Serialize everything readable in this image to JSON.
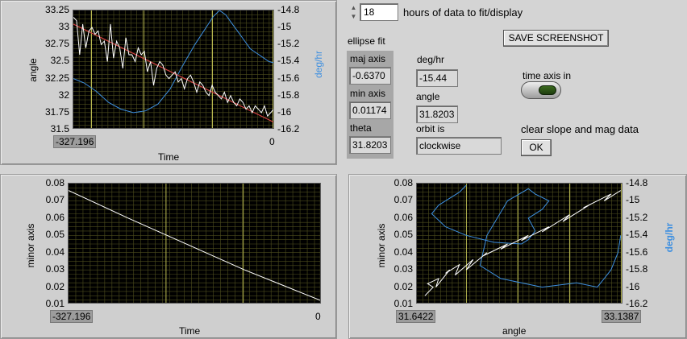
{
  "colors": {
    "panel_bg": "#d4d4d4",
    "plot_bg": "#000000",
    "grid_minor": "#4e4e1e",
    "grid_major": "#b8b850",
    "trace_white": "#ffffff",
    "trace_blue": "#3d8fe0",
    "fit_red": "#d24040",
    "toggle_led": "#2e5a14"
  },
  "controls": {
    "hours_value": "18",
    "hours_label": "hours of data to fit/display",
    "save_button": "SAVE SCREENSHOT",
    "time_axis_label": "time axis in",
    "clear_label": "clear slope and mag data",
    "ok_button": "OK"
  },
  "ellipse": {
    "title": "ellipse fit",
    "maj_axis_label": "maj axis",
    "maj_axis_value": "-0.6370",
    "min_axis_label": "min axis",
    "min_axis_value": "0.01174",
    "theta_label": "theta",
    "theta_value": "31.8203",
    "deghr_label": "deg/hr",
    "deghr_value": "-15.44",
    "angle_label": "angle",
    "angle_value": "31.8203",
    "orbit_label": "orbit is",
    "orbit_value": "clockwise"
  },
  "chart_data": [
    {
      "type": "line",
      "name": "angle vs time",
      "xlabel": "Time",
      "ylabel": "angle",
      "y2label": "deg/hr",
      "x_range_labels": [
        "-327.196",
        "0"
      ],
      "xlim": [
        -327.196,
        0
      ],
      "ylim": [
        31.5,
        33.25
      ],
      "y2lim": [
        -16.2,
        -14.8
      ],
      "yticks": [
        "33.25",
        "33",
        "32.75",
        "32.5",
        "32.25",
        "32",
        "31.75",
        "31.5"
      ],
      "y2ticks": [
        "-14.8",
        "-15",
        "-15.2",
        "-15.4",
        "-15.6",
        "-15.8",
        "-16",
        "-16.2"
      ],
      "series": [
        {
          "role": "angle",
          "color": "#ffffff",
          "axis": "left",
          "x": [
            -327,
            -322,
            -317,
            -312,
            -307,
            -302,
            -297,
            -292,
            -287,
            -282,
            -277,
            -272,
            -267,
            -262,
            -257,
            -252,
            -247,
            -242,
            -237,
            -232,
            -227,
            -222,
            -217,
            -212,
            -207,
            -202,
            -197,
            -192,
            -187,
            -182,
            -177,
            -172,
            -167,
            -162,
            -157,
            -152,
            -147,
            -142,
            -137,
            -132,
            -127,
            -122,
            -117,
            -112,
            -107,
            -102,
            -97,
            -92,
            -87,
            -82,
            -77,
            -72,
            -67,
            -62,
            -57,
            -52,
            -47,
            -42,
            -37,
            -32,
            -27,
            -22,
            -17,
            -12,
            -7,
            -2,
            0
          ],
          "y": [
            33.15,
            33.1,
            32.6,
            33.05,
            32.7,
            32.95,
            33.0,
            32.9,
            32.95,
            32.75,
            32.8,
            32.5,
            33.05,
            32.55,
            32.8,
            32.7,
            32.4,
            32.85,
            32.6,
            32.6,
            32.5,
            32.7,
            32.6,
            32.65,
            32.35,
            32.5,
            32.15,
            32.4,
            32.5,
            32.45,
            32.3,
            32.25,
            32.3,
            32.35,
            32.2,
            32.25,
            32.1,
            32.25,
            32.3,
            32.2,
            32.05,
            32.2,
            32.15,
            32.05,
            32.0,
            32.15,
            32.05,
            32.0,
            31.95,
            32.05,
            31.9,
            32.0,
            31.9,
            31.85,
            31.95,
            31.9,
            31.8,
            31.85,
            31.75,
            31.85,
            31.8,
            31.75,
            31.85,
            31.7,
            31.75,
            31.8,
            31.75
          ]
        },
        {
          "role": "fit",
          "color": "#d24040",
          "axis": "left",
          "x": [
            -327.196,
            0
          ],
          "y": [
            33.05,
            31.6
          ]
        },
        {
          "role": "deg/hr",
          "color": "#3d8fe0",
          "axis": "right",
          "x": [
            -327,
            -310,
            -290,
            -270,
            -250,
            -230,
            -210,
            -190,
            -170,
            -150,
            -130,
            -110,
            -100,
            -90,
            -80,
            -70,
            -60,
            -50,
            -40,
            -30,
            -20,
            -10,
            0
          ],
          "y": [
            -15.6,
            -15.65,
            -15.75,
            -15.88,
            -15.96,
            -16.0,
            -15.98,
            -15.9,
            -15.72,
            -15.45,
            -15.2,
            -14.98,
            -14.87,
            -14.8,
            -14.85,
            -14.95,
            -15.05,
            -15.15,
            -15.25,
            -15.3,
            -15.35,
            -15.4,
            -15.42
          ]
        }
      ]
    },
    {
      "type": "line",
      "name": "minor axis vs time",
      "xlabel": "Time",
      "ylabel": "minor axis",
      "x_range_labels": [
        "-327.196",
        "0"
      ],
      "xlim": [
        -327.196,
        0
      ],
      "ylim": [
        0.01,
        0.08
      ],
      "yticks": [
        "0.08",
        "0.07",
        "0.06",
        "0.05",
        "0.04",
        "0.03",
        "0.02",
        "0.01"
      ],
      "series": [
        {
          "role": "minor axis",
          "color": "#ffffff",
          "x": [
            -327.196,
            -250,
            -200,
            -150,
            -100,
            -50,
            0
          ],
          "y": [
            0.076,
            0.06,
            0.05,
            0.04,
            0.03,
            0.021,
            0.012
          ]
        }
      ]
    },
    {
      "type": "scatter",
      "name": "minor axis vs angle",
      "xlabel": "angle",
      "ylabel": "minor axis",
      "y2label": "deg/hr",
      "x_range_labels": [
        "31.6422",
        "33.1387"
      ],
      "xlim": [
        31.6422,
        33.1387
      ],
      "ylim": [
        0.01,
        0.08
      ],
      "y2lim": [
        -16.2,
        -14.8
      ],
      "yticks": [
        "0.08",
        "0.07",
        "0.06",
        "0.05",
        "0.04",
        "0.03",
        "0.02",
        "0.01"
      ],
      "y2ticks": [
        "-14.8",
        "-15",
        "-15.2",
        "-15.4",
        "-15.6",
        "-15.8",
        "-16",
        "-16.2"
      ],
      "series": [
        {
          "role": "minor axis",
          "color": "#ffffff",
          "axis": "left",
          "x": [
            31.7,
            31.76,
            31.72,
            31.8,
            31.78,
            31.88,
            31.85,
            31.95,
            31.92,
            32.05,
            32.0,
            32.15,
            32.12,
            32.3,
            32.25,
            32.45,
            32.4,
            32.6,
            32.55,
            32.75,
            32.7,
            32.9,
            32.85,
            33.05,
            33.0,
            33.12
          ],
          "y": [
            0.015,
            0.02,
            0.022,
            0.025,
            0.02,
            0.03,
            0.028,
            0.033,
            0.027,
            0.036,
            0.03,
            0.04,
            0.038,
            0.045,
            0.042,
            0.05,
            0.047,
            0.055,
            0.052,
            0.062,
            0.058,
            0.068,
            0.066,
            0.074,
            0.07,
            0.076
          ]
        },
        {
          "role": "deg/hr",
          "color": "#3d8fe0",
          "axis": "right",
          "x": [
            32.0,
            31.95,
            31.8,
            31.75,
            31.85,
            32.0,
            32.2,
            32.4,
            32.45,
            32.5,
            32.45,
            32.55,
            32.6,
            32.5,
            32.45,
            32.3,
            32.15,
            32.1,
            32.25,
            32.55,
            32.8,
            32.95,
            33.0,
            33.05,
            33.1,
            33.12
          ],
          "y": [
            -14.82,
            -14.9,
            -15.05,
            -15.15,
            -15.3,
            -15.4,
            -15.48,
            -15.5,
            -15.45,
            -15.35,
            -15.2,
            -15.1,
            -15.0,
            -14.92,
            -14.86,
            -15.0,
            -15.4,
            -15.75,
            -15.9,
            -16.0,
            -15.95,
            -16.0,
            -15.9,
            -15.8,
            -15.6,
            -15.4
          ]
        }
      ]
    }
  ]
}
